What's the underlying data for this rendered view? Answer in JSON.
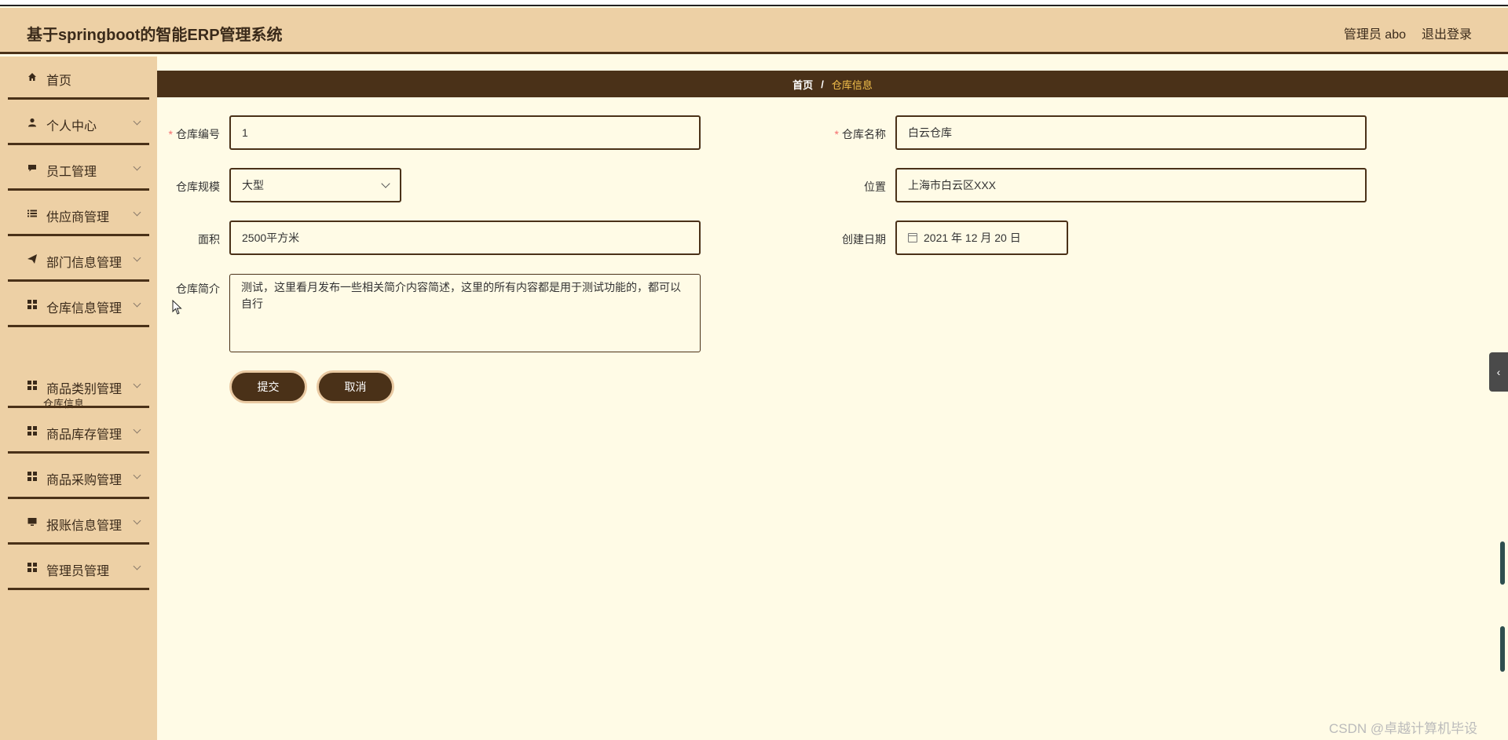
{
  "header": {
    "title": "基于springboot的智能ERP管理系统",
    "user": "管理员 abo",
    "logout": "退出登录"
  },
  "sidebar": {
    "items": [
      {
        "label": "首页",
        "icon": "home-icon",
        "has_children": false
      },
      {
        "label": "个人中心",
        "icon": "user-icon",
        "has_children": true
      },
      {
        "label": "员工管理",
        "icon": "chat-icon",
        "has_children": true
      },
      {
        "label": "供应商管理",
        "icon": "list-icon",
        "has_children": true
      },
      {
        "label": "部门信息管理",
        "icon": "send-icon",
        "has_children": true
      },
      {
        "label": "仓库信息管理",
        "icon": "grid-icon",
        "has_children": true,
        "expanded": true
      },
      {
        "label": "商品类别管理",
        "icon": "grid-icon",
        "has_children": true
      },
      {
        "label": "商品库存管理",
        "icon": "grid-icon",
        "has_children": true
      },
      {
        "label": "商品采购管理",
        "icon": "grid-icon",
        "has_children": true
      },
      {
        "label": "报账信息管理",
        "icon": "monitor-icon",
        "has_children": true
      },
      {
        "label": "管理员管理",
        "icon": "grid-icon",
        "has_children": true
      }
    ],
    "submenu": {
      "label": "仓库信息"
    }
  },
  "breadcrumb": {
    "home": "首页",
    "separator": "/",
    "current": "仓库信息"
  },
  "form": {
    "warehouse_no": {
      "label": "仓库编号",
      "value": "1",
      "required": true
    },
    "warehouse_name": {
      "label": "仓库名称",
      "value": "白云仓库",
      "required": true
    },
    "warehouse_scale": {
      "label": "仓库规模",
      "value": "大型"
    },
    "location": {
      "label": "位置",
      "value": "上海市白云区XXX"
    },
    "area": {
      "label": "面积",
      "value": "2500平方米"
    },
    "created_date": {
      "label": "创建日期",
      "value": "2021 年 12 月 20 日"
    },
    "intro": {
      "label": "仓库简介",
      "value": "测试，这里看月发布一些相关简介内容简述，这里的所有内容都是用于测试功能的，都可以自行"
    }
  },
  "buttons": {
    "submit": "提交",
    "cancel": "取消"
  },
  "watermark": "CSDN @卓越计算机毕设",
  "colors": {
    "header_bg": "#edd0a5",
    "accent_dark": "#4a3118",
    "page_bg": "#fffbe6",
    "breadcrumb_current": "#f4c14b",
    "required": "#f56c6c"
  }
}
